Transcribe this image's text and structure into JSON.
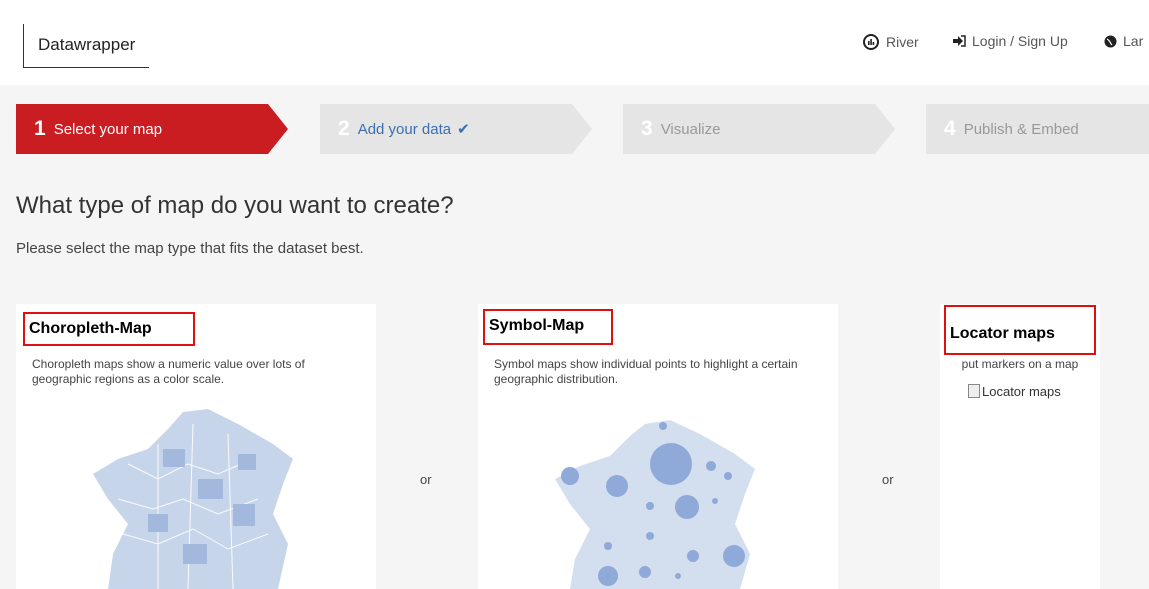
{
  "header": {
    "logo": "Datawrapper",
    "nav": [
      {
        "label": "River",
        "icon": "river-icon"
      },
      {
        "label": "Login / Sign Up",
        "icon": "login-icon"
      },
      {
        "label": "Lar",
        "icon": "globe-icon"
      }
    ]
  },
  "steps": [
    {
      "num": "1",
      "label": "Select your map",
      "state": "active"
    },
    {
      "num": "2",
      "label": "Add your data",
      "state": "done"
    },
    {
      "num": "3",
      "label": "Visualize",
      "state": "inactive"
    },
    {
      "num": "4",
      "label": "Publish & Embed",
      "state": "inactive"
    }
  ],
  "main": {
    "title": "What type of map do you want to create?",
    "subtitle": "Please select the map type that fits the dataset best.",
    "or_label": "or",
    "cards": [
      {
        "title": "Choropleth-Map",
        "desc": "Choropleth maps show a numeric value over lots of geographic regions as a color scale."
      },
      {
        "title": "Symbol-Map",
        "desc": "Symbol maps show individual points to highlight a certain geographic distribution."
      },
      {
        "title": "Locator maps",
        "desc": "put markers on a map",
        "image_alt": "Locator maps"
      }
    ]
  },
  "colors": {
    "accent": "#c91d22",
    "highlight_box": "#e01010",
    "link_blue": "#3a6fb0",
    "map_fill": "#c7d5ea",
    "symbol_fill": "#8fa9d8"
  }
}
